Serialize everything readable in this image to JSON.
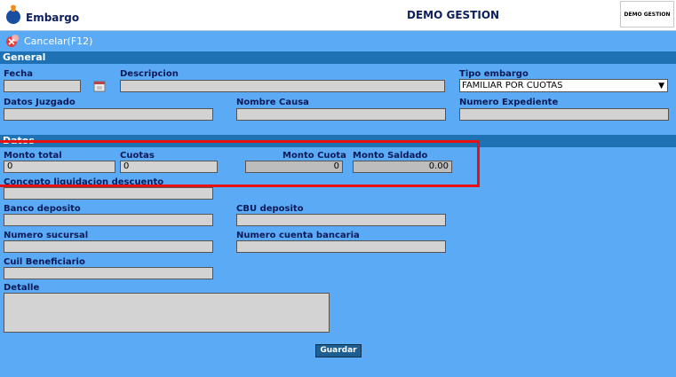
{
  "app": {
    "title": "Embargo",
    "center_title": "DEMO GESTION",
    "corner_label": "DEMO GESTION"
  },
  "toolbar": {
    "cancel_label": "Cancelar(F12)"
  },
  "sections": {
    "general": "General",
    "datos": "Datos"
  },
  "general": {
    "fecha": {
      "label": "Fecha",
      "value": ""
    },
    "descripcion": {
      "label": "Descripcion",
      "value": ""
    },
    "tipo_embargo": {
      "label": "Tipo embargo",
      "value": "FAMILIAR POR CUOTAS"
    },
    "datos_juzgado": {
      "label": "Datos Juzgado",
      "value": ""
    },
    "nombre_causa": {
      "label": "Nombre Causa",
      "value": ""
    },
    "numero_expediente": {
      "label": "Numero Expediente",
      "value": ""
    }
  },
  "datos": {
    "monto_total": {
      "label": "Monto total",
      "value": "0"
    },
    "cuotas": {
      "label": "Cuotas",
      "value": "0"
    },
    "monto_cuota": {
      "label": "Monto Cuota",
      "value": "0"
    },
    "monto_saldado": {
      "label": "Monto Saldado",
      "value": "0.00"
    },
    "concepto": {
      "label": "Concepto liquidacion descuento",
      "value": ""
    },
    "banco_deposito": {
      "label": "Banco deposito",
      "value": ""
    },
    "cbu_deposito": {
      "label": "CBU deposito",
      "value": ""
    },
    "numero_sucursal": {
      "label": "Numero sucursal",
      "value": ""
    },
    "numero_cuenta": {
      "label": "Numero cuenta bancaria",
      "value": ""
    },
    "cuil_beneficiario": {
      "label": "Cuil Beneficiario",
      "value": ""
    },
    "detalle": {
      "label": "Detalle",
      "value": ""
    }
  },
  "actions": {
    "guardar": "Guardar"
  },
  "colors": {
    "background": "#5aaaf5",
    "section_header": "#1e72b3",
    "highlight": "#e81010"
  }
}
